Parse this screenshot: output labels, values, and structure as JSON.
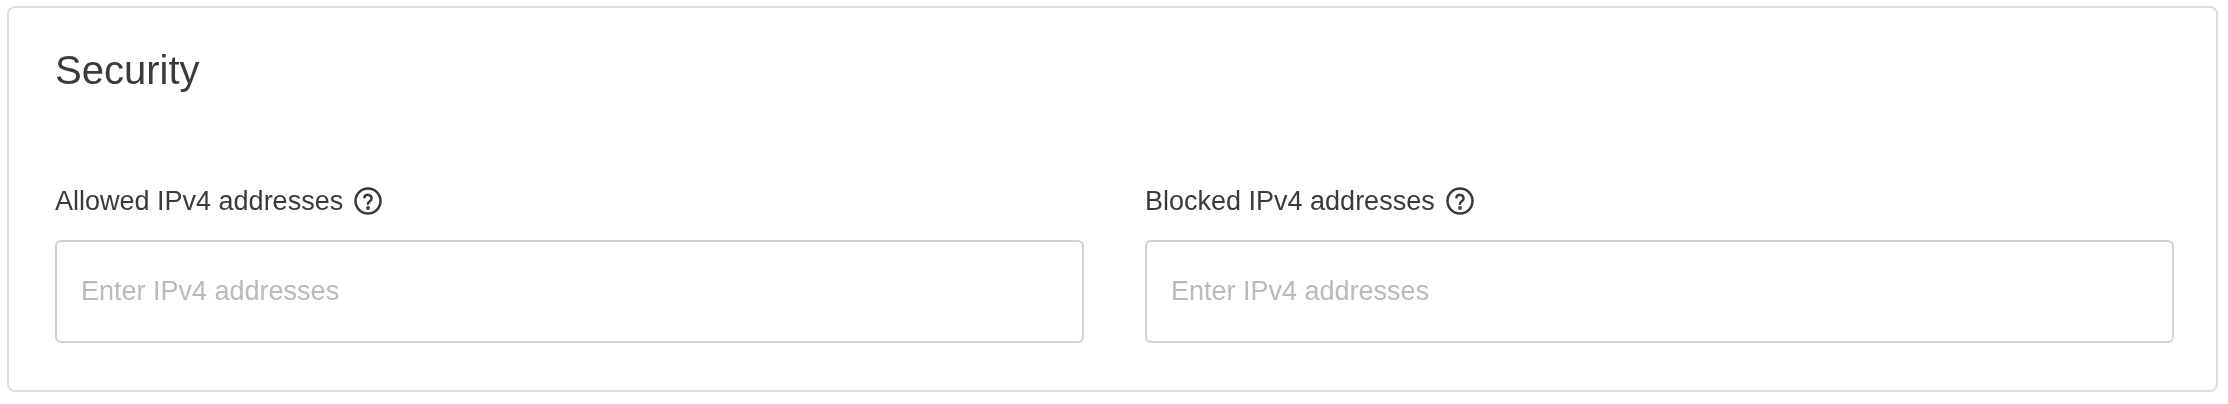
{
  "section": {
    "title": "Security"
  },
  "fields": [
    {
      "label": "Allowed IPv4 addresses",
      "placeholder": "Enter IPv4 addresses"
    },
    {
      "label": "Blocked IPv4 addresses",
      "placeholder": "Enter IPv4 addresses"
    }
  ]
}
